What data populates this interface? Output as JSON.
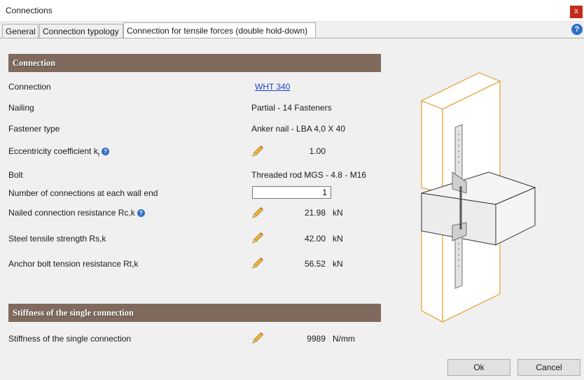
{
  "window": {
    "title": "Connections",
    "close_label": "x"
  },
  "tabs": [
    {
      "label": "General"
    },
    {
      "label": "Connection typology"
    },
    {
      "label": "Connection for tensile forces (double hold-down)"
    }
  ],
  "help_label": "?",
  "sections": {
    "connection": "Connection",
    "stiffness": "Stiffness of the single connection"
  },
  "rows": {
    "connection": {
      "label": "Connection",
      "value": "WHT 340"
    },
    "nailing": {
      "label": "Nailing",
      "value": "Partial - 14 Fasteners"
    },
    "fastener": {
      "label": "Fastener type",
      "value": "Anker nail - LBA 4,0 X 40"
    },
    "eccentricity": {
      "label": "Eccentricity coefficient  k",
      "subscript": "t",
      "value": "1.00"
    },
    "bolt": {
      "label": "Bolt",
      "value": "Threaded rod MGS - 4.8 - M16"
    },
    "num_connections": {
      "label": "Number of connections at each wall end",
      "value": "1"
    },
    "nailed_resistance": {
      "label": "Nailed connection resistance  Rc,k",
      "value": "21.98",
      "unit": "kN"
    },
    "steel_strength": {
      "label": "Steel tensile strength Rs,k",
      "value": "42.00",
      "unit": "kN"
    },
    "anchor_resistance": {
      "label": "Anchor bolt tension resistance Rt,k",
      "value": "56.52",
      "unit": "kN"
    },
    "stiffness": {
      "label": "Stiffness of the single connection",
      "value": "9989",
      "unit": "N/mm"
    }
  },
  "buttons": {
    "ok": "Ok",
    "cancel": "Cancel"
  },
  "colors": {
    "section_header": "#7f6a5d",
    "accent_blue": "#2f6fc4",
    "close_red": "#c42b1c",
    "wall_outline": "#e0a030"
  }
}
